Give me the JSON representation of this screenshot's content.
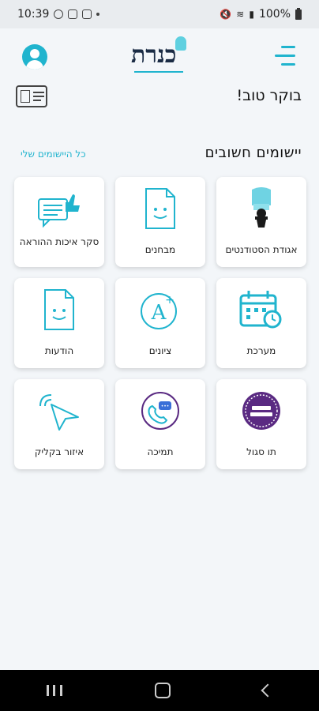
{
  "status_bar": {
    "time": "10:39",
    "battery": "100%"
  },
  "header": {
    "logo_text": "כנרת"
  },
  "greeting": "בוקר טוב!",
  "section": {
    "title": "יישומים חשובים",
    "all_link": "כל היישומים שלי"
  },
  "tiles": [
    {
      "label": "אגודת הסטודנטים",
      "icon": "student-union-icon"
    },
    {
      "label": "מבחנים",
      "icon": "exam-icon"
    },
    {
      "label": "סקר איכות ההוראה",
      "icon": "survey-icon"
    },
    {
      "label": "מערכת",
      "icon": "calendar-icon"
    },
    {
      "label": "ציונים",
      "icon": "grade-icon"
    },
    {
      "label": "הודעות",
      "icon": "messages-icon"
    },
    {
      "label": "תו סגול",
      "icon": "purple-badge-icon"
    },
    {
      "label": "תמיכה",
      "icon": "support-icon"
    },
    {
      "label": "איזור בקליק",
      "icon": "click-icon"
    }
  ],
  "colors": {
    "accent": "#20b4ce",
    "purple": "#5a2a82",
    "background": "#f3f6f9"
  }
}
